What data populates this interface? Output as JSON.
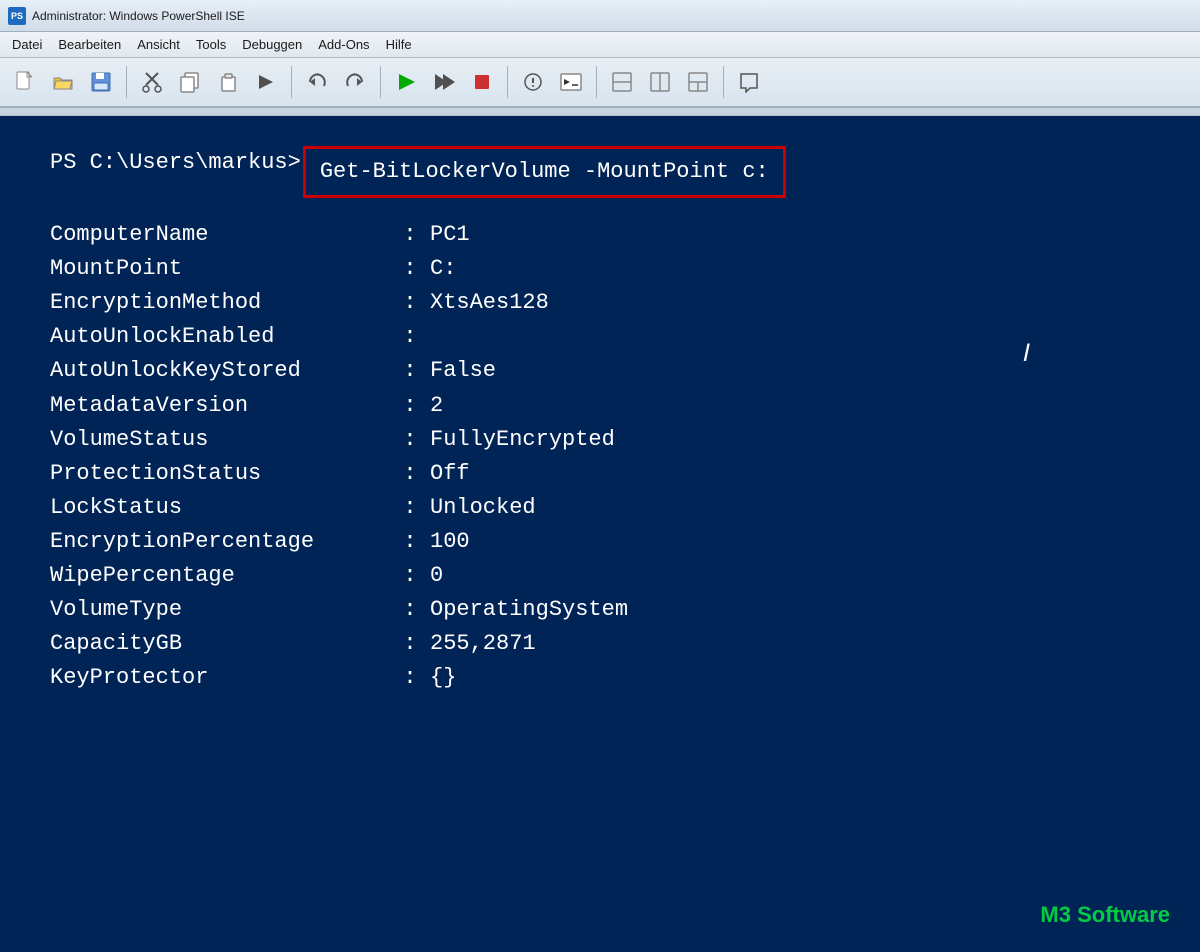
{
  "titlebar": {
    "icon_label": "PS",
    "title": "Administrator: Windows PowerShell ISE"
  },
  "menubar": {
    "items": [
      {
        "label": "Datei"
      },
      {
        "label": "Bearbeiten"
      },
      {
        "label": "Ansicht"
      },
      {
        "label": "Tools"
      },
      {
        "label": "Debuggen"
      },
      {
        "label": "Add-Ons"
      },
      {
        "label": "Hilfe"
      }
    ]
  },
  "toolbar": {
    "buttons": [
      {
        "name": "new-file-btn",
        "icon": "📄"
      },
      {
        "name": "open-btn",
        "icon": "📂"
      },
      {
        "name": "save-btn",
        "icon": "💾"
      },
      {
        "name": "cut-btn",
        "icon": "✂"
      },
      {
        "name": "copy-btn",
        "icon": "📋"
      },
      {
        "name": "paste-btn",
        "icon": "📌"
      },
      {
        "name": "arrow-btn",
        "icon": "➤"
      },
      {
        "name": "sep1",
        "type": "sep"
      },
      {
        "name": "undo-btn",
        "icon": "↩"
      },
      {
        "name": "redo-btn",
        "icon": "↪"
      },
      {
        "name": "sep2",
        "type": "sep"
      },
      {
        "name": "run-btn",
        "icon": "▶",
        "color": "#00aa00"
      },
      {
        "name": "run-sel-btn",
        "icon": "⏩"
      },
      {
        "name": "stop-btn",
        "icon": "⏹"
      },
      {
        "name": "sep3",
        "type": "sep"
      },
      {
        "name": "debug-btn",
        "icon": "🔍"
      },
      {
        "name": "console-btn",
        "icon": "▣"
      },
      {
        "name": "sep4",
        "type": "sep"
      },
      {
        "name": "layout1-btn",
        "icon": "⬜"
      },
      {
        "name": "layout2-btn",
        "icon": "⬛"
      },
      {
        "name": "layout3-btn",
        "icon": "⬜"
      },
      {
        "name": "sep5",
        "type": "sep"
      },
      {
        "name": "help-btn",
        "icon": "❓"
      }
    ]
  },
  "console": {
    "prompt": "PS C:\\Users\\markus>",
    "command": "Get-BitLockerVolume -MountPoint c:",
    "output": [
      {
        "key": "ComputerName",
        "sep": ":",
        "val": "PC1"
      },
      {
        "key": "MountPoint",
        "sep": ":",
        "val": "C:"
      },
      {
        "key": "EncryptionMethod",
        "sep": ":",
        "val": "XtsAes128"
      },
      {
        "key": "AutoUnlockEnabled",
        "sep": ":",
        "val": ""
      },
      {
        "key": "AutoUnlockKeyStored",
        "sep": ":",
        "val": "False"
      },
      {
        "key": "MetadataVersion",
        "sep": ":",
        "val": "2"
      },
      {
        "key": "VolumeStatus",
        "sep": ":",
        "val": "FullyEncrypted"
      },
      {
        "key": "ProtectionStatus",
        "sep": ":",
        "val": "Off"
      },
      {
        "key": "LockStatus",
        "sep": ":",
        "val": "Unlocked"
      },
      {
        "key": "EncryptionPercentage",
        "sep": ":",
        "val": "100"
      },
      {
        "key": "WipePercentage",
        "sep": ":",
        "val": "0"
      },
      {
        "key": "VolumeType",
        "sep": ":",
        "val": "OperatingSystem"
      },
      {
        "key": "CapacityGB",
        "sep": ":",
        "val": "255,2871"
      },
      {
        "key": "KeyProtector",
        "sep": ":",
        "val": "{}"
      }
    ]
  },
  "branding": {
    "m3": "M3",
    "software": " Software"
  }
}
